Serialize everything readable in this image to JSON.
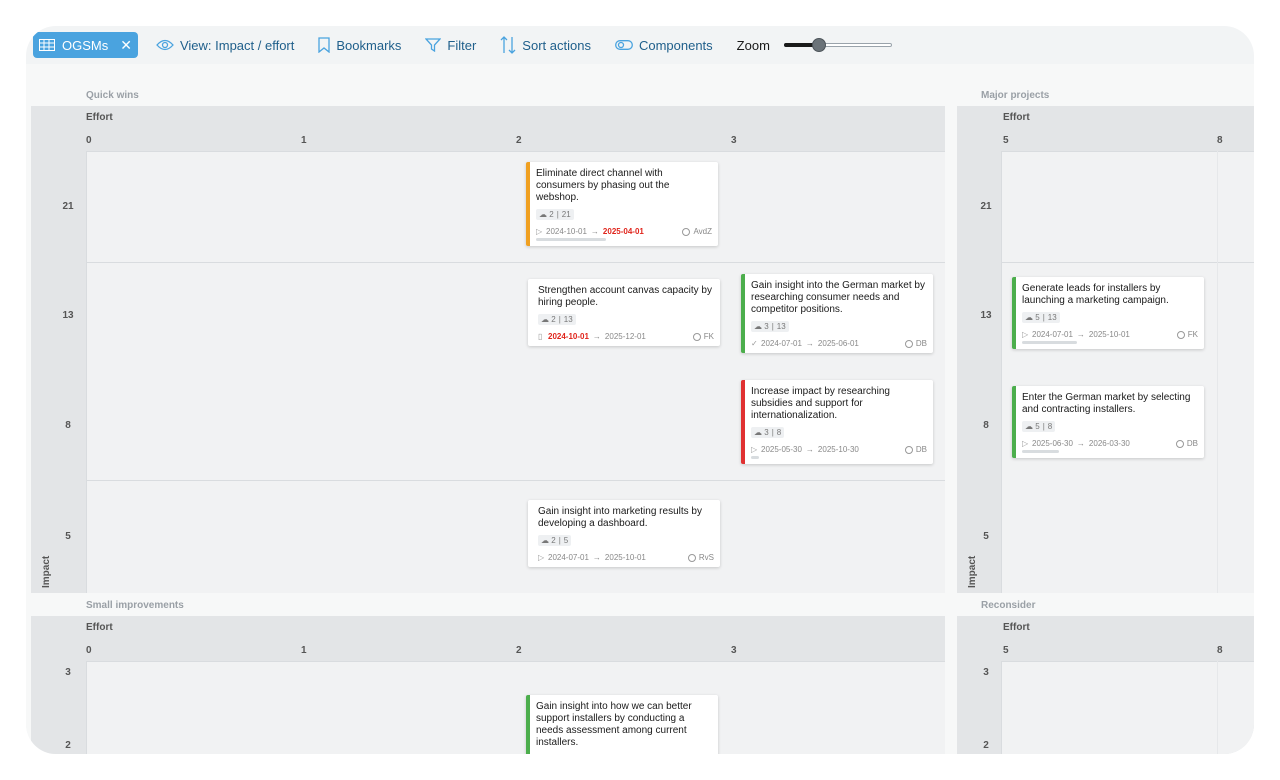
{
  "toolbar": {
    "ogsm_chip": "OGSMs",
    "view_label": "View: Impact / effort",
    "bookmarks_label": "Bookmarks",
    "filter_label": "Filter",
    "sort_label": "Sort actions",
    "components_label": "Components",
    "zoom_label": "Zoom",
    "zoom_level": 0.3
  },
  "quadrants": {
    "quick_wins": {
      "label": "Quick wins",
      "effort_label": "Effort",
      "ticks": [
        "0",
        "1",
        "2",
        "3"
      ],
      "impact_label": "Impact",
      "rows": [
        "21",
        "13",
        "8",
        "5"
      ]
    },
    "major_projects": {
      "label": "Major projects",
      "effort_label": "Effort",
      "ticks": [
        "5",
        "8"
      ],
      "impact_label": "Impact",
      "rows": [
        "21",
        "13",
        "8",
        "5"
      ]
    },
    "small_improvements": {
      "label": "Small improvements",
      "effort_label": "Effort",
      "ticks": [
        "0",
        "1",
        "2",
        "3"
      ],
      "rows": [
        "3",
        "2"
      ]
    },
    "reconsider": {
      "label": "Reconsider",
      "effort_label": "Effort",
      "ticks": [
        "5",
        "8"
      ],
      "rows": [
        "3",
        "2"
      ]
    }
  },
  "cards": [
    {
      "title": "Eliminate direct channel with consumers by phasing out the webshop.",
      "effort": "2",
      "impact": "21",
      "start": "2024-10-01",
      "end": "2025-04-01",
      "owner": "AvdZ",
      "status_color": "#f0a020",
      "progress": 0.45
    },
    {
      "title": "Strengthen account canvas capacity by hiring people.",
      "effort": "2",
      "impact": "13",
      "start": "2024-10-01",
      "end": "2025-12-01",
      "owner": "FK",
      "status_color": "#ffffff",
      "progress": 0
    },
    {
      "title": "Gain insight into the German market by researching consumer needs and competitor positions.",
      "effort": "3",
      "impact": "13",
      "start": "2024-07-01",
      "end": "2025-06-01",
      "owner": "DB",
      "status_color": "#4cae4c",
      "progress": 0
    },
    {
      "title": "Increase impact by researching subsidies and support for internationalization.",
      "effort": "3",
      "impact": "8",
      "start": "2025-05-30",
      "end": "2025-10-30",
      "owner": "DB",
      "status_color": "#e03131",
      "progress": 0.05
    },
    {
      "title": "Gain insight into marketing results by developing a dashboard.",
      "effort": "2",
      "impact": "5",
      "start": "2024-07-01",
      "end": "2025-10-01",
      "owner": "RvS",
      "status_color": "#ffffff",
      "progress": 0
    },
    {
      "title": "Generate leads for installers by launching a marketing campaign.",
      "effort": "5",
      "impact": "13",
      "start": "2024-07-01",
      "end": "2025-10-01",
      "owner": "FK",
      "status_color": "#4cae4c",
      "progress": 0.3
    },
    {
      "title": "Enter the German market by selecting and contracting installers.",
      "effort": "5",
      "impact": "8",
      "start": "2025-06-30",
      "end": "2026-03-30",
      "owner": "DB",
      "status_color": "#4cae4c",
      "progress": 0.2
    },
    {
      "title": "Gain insight into how we can better support installers by conducting a needs assessment among current installers.",
      "status_color": "#4cae4c"
    }
  ]
}
